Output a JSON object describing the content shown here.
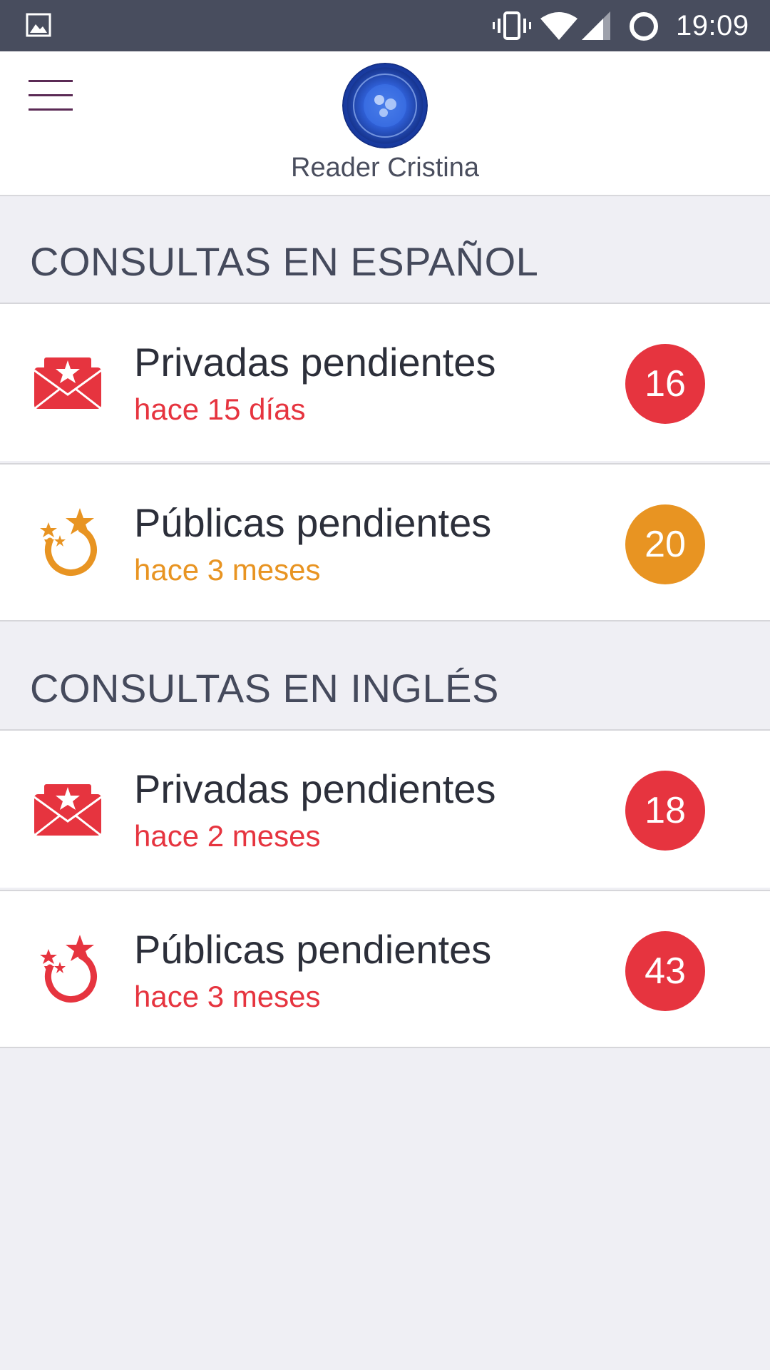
{
  "status_bar": {
    "time": "19:09",
    "icons": [
      "image-icon",
      "vibrate-icon",
      "wifi-icon",
      "signal-icon",
      "loading-icon"
    ]
  },
  "header": {
    "menu_icon": "hamburger-menu-icon",
    "reader_name": "Reader Cristina"
  },
  "colors": {
    "red": "#e6343f",
    "orange": "#e89422",
    "status_bar": "#484d5e",
    "background": "#efeff4"
  },
  "sections": [
    {
      "title": "CONSULTAS EN ESPAÑOL",
      "rows": [
        {
          "title": "Privadas pendientes",
          "subtitle": "hace 15 días",
          "count": "16",
          "icon": "private-mail-icon",
          "color": "red"
        },
        {
          "title": "Públicas pendientes",
          "subtitle": "hace 3 meses",
          "count": "20",
          "icon": "public-stars-icon",
          "color": "orange"
        }
      ]
    },
    {
      "title": "CONSULTAS EN INGLÉS",
      "rows": [
        {
          "title": "Privadas pendientes",
          "subtitle": "hace 2 meses",
          "count": "18",
          "icon": "private-mail-icon",
          "color": "red"
        },
        {
          "title": "Públicas pendientes",
          "subtitle": "hace 3 meses",
          "count": "43",
          "icon": "public-stars-icon",
          "color": "red"
        }
      ]
    }
  ]
}
